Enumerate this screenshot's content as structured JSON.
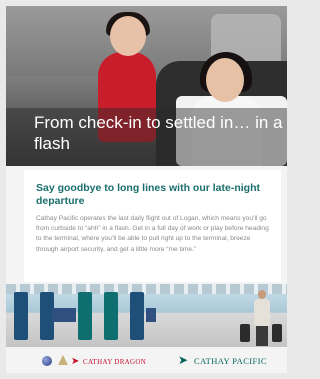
{
  "hero": {
    "headline": "From check-in to settled in… in a flash"
  },
  "content": {
    "subhead": "Say goodbye to long lines with our late-night departure",
    "body": "Cathay Pacific operates the last daily flight out of Logan, which means you’ll go from curbside to “ahh” in a flash. Get in a full day of work or play before heading to the terminal, where you’ll be able to pull right up to the terminal, breeze through airport security, and get a little more “me time.”"
  },
  "logos": {
    "dragon": "CATHAY DRAGON",
    "pacific": "CATHAY PACIFIC"
  },
  "colors": {
    "accent_teal": "#1a6e6c",
    "dragon_red": "#c8102e",
    "pacific_green": "#00645a"
  }
}
